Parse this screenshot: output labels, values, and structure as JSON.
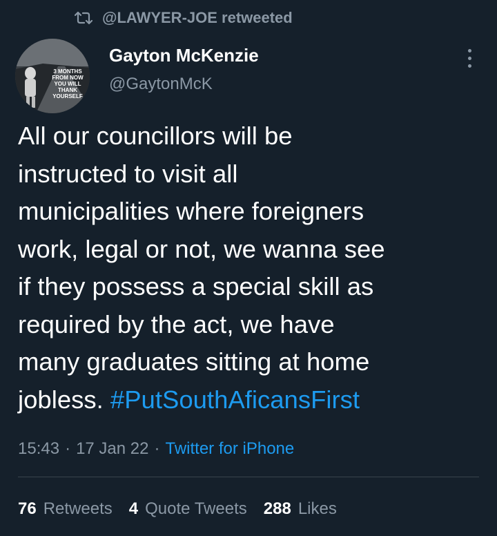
{
  "retweet": {
    "icon": "retweet-icon",
    "text": "@LAWYER-JOE retweeted"
  },
  "author": {
    "display_name": "Gayton McKenzie",
    "handle": "@GaytonMcK",
    "avatar_caption": "3 MONTHS FROM NOW YOU WILL THANK YOURSELF"
  },
  "tweet": {
    "text": "All our councillors will be\ninstructed to visit all\nmunicipalities where foreigners\nwork, legal or not, we wanna see\nif they possess a special skill as\nrequired by the act, we have\nmany graduates sitting at home\njobless. ",
    "hashtag": "#PutSouthAficansFirst"
  },
  "meta": {
    "time": "15:43",
    "sep1": "·",
    "date": "17 Jan 22",
    "sep2": "·",
    "source": "Twitter for iPhone"
  },
  "stats": {
    "retweets_count": "76",
    "retweets_label": "Retweets",
    "quotes_count": "4",
    "quotes_label": "Quote Tweets",
    "likes_count": "288",
    "likes_label": "Likes"
  },
  "colors": {
    "background": "#15202b",
    "secondary_text": "#8b98a5",
    "link": "#1d9bf0",
    "divider": "#38444d"
  }
}
